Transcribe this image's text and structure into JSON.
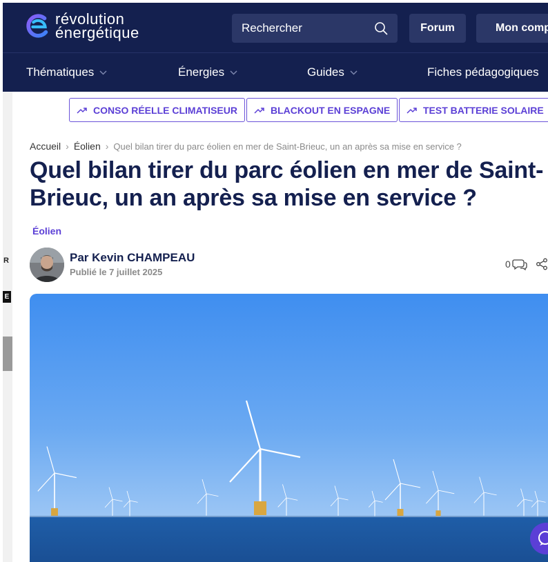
{
  "logo": {
    "line1": "révolution",
    "line2": "énergétique"
  },
  "header": {
    "search_label": "Rechercher",
    "forum_label": "Forum",
    "account_label": "Mon compte"
  },
  "nav": [
    {
      "label": "Thématiques"
    },
    {
      "label": "Énergies"
    },
    {
      "label": "Guides"
    },
    {
      "label": "Fiches pédagogiques"
    }
  ],
  "trends": [
    {
      "label": "CONSO RÉELLE CLIMATISEUR"
    },
    {
      "label": "BLACKOUT EN ESPAGNE"
    },
    {
      "label": "TEST BATTERIE SOLAIRE"
    }
  ],
  "sidebar": {
    "letter_r": "R",
    "letter_e": "E"
  },
  "breadcrumb": {
    "home": "Accueil",
    "section": "Éolien",
    "current": "Quel bilan tirer du parc éolien en mer de Saint-Brieuc, un an après sa mise en service ?"
  },
  "article": {
    "title": "Quel bilan tirer du parc éolien en mer de Saint-Brieuc, un an après sa mise en service ?",
    "category": "Éolien",
    "author": "Par Kevin CHAMPEAU",
    "date": "Publié le 7 juillet 2025",
    "comment_count": "0"
  },
  "colors": {
    "header_bg": "#14204f",
    "accent": "#5b3fd6",
    "title": "#14204f"
  }
}
